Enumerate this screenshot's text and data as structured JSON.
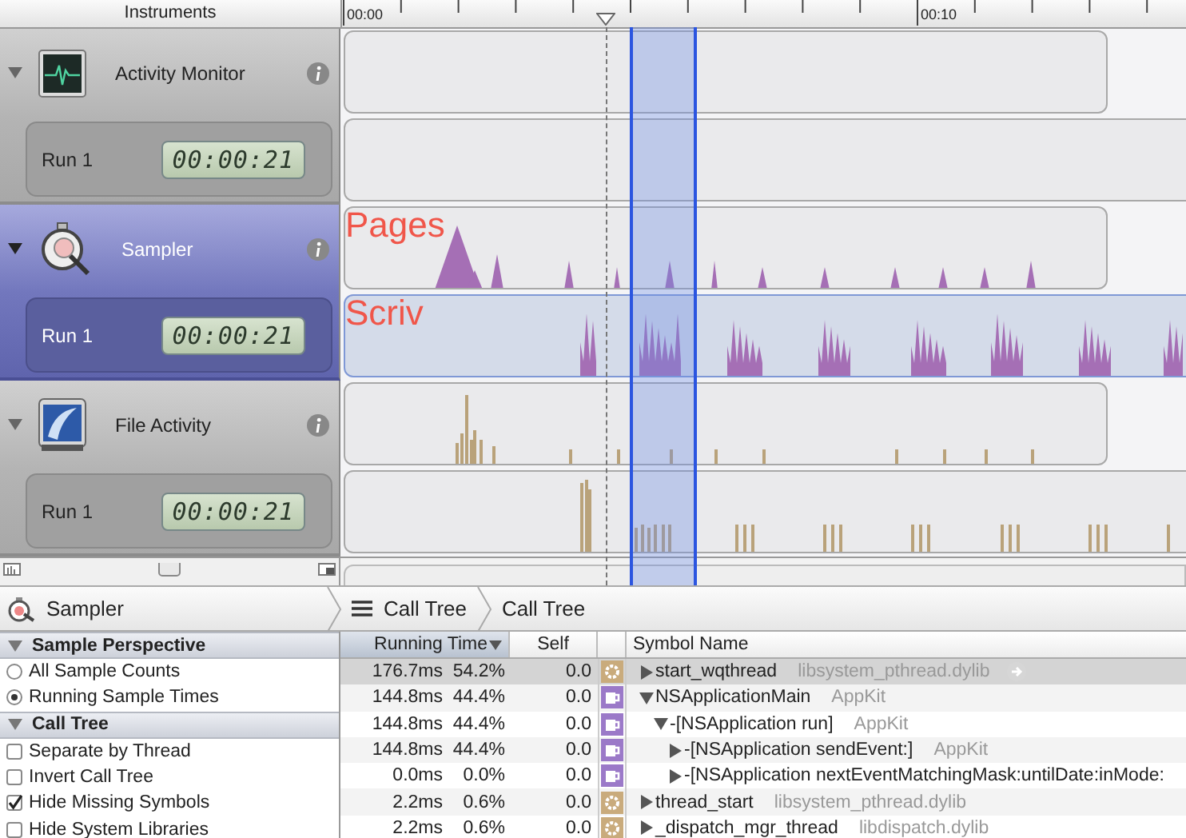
{
  "ruler": {
    "title": "Instruments",
    "ticks": [
      "00:00",
      "00:10"
    ]
  },
  "instruments": [
    {
      "name": "Activity Monitor",
      "kind": "activity",
      "selected": false,
      "expanded": true,
      "run": {
        "label": "Run 1",
        "time": "00:00:21",
        "selected": false
      }
    },
    {
      "name": "Sampler",
      "kind": "sampler",
      "selected": true,
      "expanded": true,
      "track_label": "Pages",
      "run": {
        "label": "Run 1",
        "time": "00:00:21",
        "selected": true,
        "track_label": "Scriv"
      }
    },
    {
      "name": "File Activity",
      "kind": "file",
      "selected": false,
      "expanded": true,
      "run": {
        "label": "Run 1",
        "time": "00:00:21",
        "selected": false
      }
    }
  ],
  "breadcrumb": [
    {
      "label": "Sampler",
      "kind": "instrument"
    },
    {
      "label": "Call Tree",
      "kind": "view"
    },
    {
      "label": "Call Tree",
      "kind": "plain"
    }
  ],
  "settings": [
    {
      "title": "Sample Perspective",
      "expanded": true,
      "options": [
        {
          "label": "All Sample Counts",
          "kind": "radio",
          "selected": false
        },
        {
          "label": "Running Sample Times",
          "kind": "radio",
          "selected": true
        }
      ]
    },
    {
      "title": "Call Tree",
      "expanded": true,
      "options": [
        {
          "label": "Separate by Thread",
          "kind": "checkbox",
          "checked": false
        },
        {
          "label": "Invert Call Tree",
          "kind": "checkbox",
          "checked": false
        },
        {
          "label": "Hide Missing Symbols",
          "kind": "checkbox",
          "checked": true
        },
        {
          "label": "Hide System Libraries",
          "kind": "checkbox",
          "checked": false
        }
      ]
    }
  ],
  "table": {
    "columns": [
      {
        "label": "Running Time",
        "sorted": true
      },
      {
        "label": "Self",
        "sorted": false
      },
      {
        "label": "Symbol Name",
        "sorted": false
      }
    ],
    "rows": [
      {
        "time": "176.7ms",
        "percent": "54.2%",
        "self": "0.0",
        "kind": "gear",
        "symbol": "start_wqthread",
        "library": "libsystem_pthread.dylib",
        "expanded": false,
        "selected": true
      },
      {
        "time": "144.8ms",
        "percent": "44.4%",
        "self": "0.0",
        "kind": "cup",
        "symbol": "NSApplicationMain",
        "library": "AppKit",
        "expanded": true,
        "selected": false,
        "children": [
          {
            "time": "144.8ms",
            "percent": "44.4%",
            "self": "0.0",
            "kind": "cup",
            "symbol": "-[NSApplication run]",
            "library": "AppKit",
            "expanded": true,
            "selected": false,
            "children": [
              {
                "time": "144.8ms",
                "percent": "44.4%",
                "self": "0.0",
                "kind": "cup",
                "symbol": "-[NSApplication sendEvent:]",
                "library": "AppKit",
                "expanded": false,
                "selected": false
              },
              {
                "time": "0.0ms",
                "percent": "0.0%",
                "self": "0.0",
                "kind": "cup",
                "symbol": "-[NSApplication nextEventMatchingMask:untilDate:inMode:",
                "expanded": false,
                "selected": false
              }
            ]
          }
        ]
      },
      {
        "time": "2.2ms",
        "percent": "0.6%",
        "self": "0.0",
        "kind": "gear",
        "symbol": "thread_start",
        "library": "libsystem_pthread.dylib",
        "expanded": false,
        "selected": false
      },
      {
        "time": "2.2ms",
        "percent": "0.6%",
        "self": "0.0",
        "kind": "gear",
        "symbol": "_dispatch_mgr_thread",
        "library": "libdispatch.dylib",
        "expanded": false,
        "selected": false
      }
    ]
  }
}
